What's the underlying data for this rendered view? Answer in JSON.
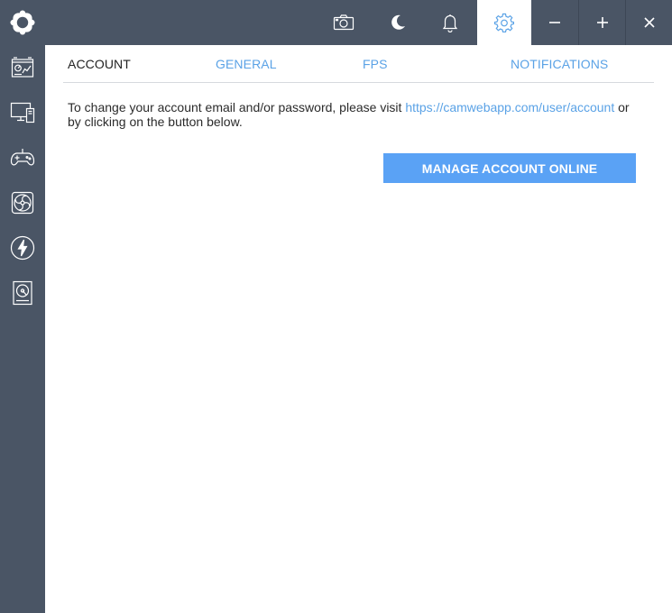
{
  "titlebar": {
    "buttons": [
      {
        "name": "screenshot",
        "icon": "camera-icon"
      },
      {
        "name": "dark-mode",
        "icon": "moon-icon"
      },
      {
        "name": "notifications",
        "icon": "bell-icon"
      },
      {
        "name": "settings",
        "icon": "gear-icon",
        "active": true
      },
      {
        "name": "minimize",
        "icon": "minus-icon"
      },
      {
        "name": "maximize",
        "icon": "plus-icon"
      },
      {
        "name": "close",
        "icon": "close-icon"
      }
    ]
  },
  "sidebar": {
    "items": [
      {
        "icon": "dashboard-icon"
      },
      {
        "icon": "monitor-icon"
      },
      {
        "icon": "gamepad-icon"
      },
      {
        "icon": "fan-icon"
      },
      {
        "icon": "lightning-icon"
      },
      {
        "icon": "storage-drive-icon"
      }
    ]
  },
  "tabs": [
    {
      "label": "ACCOUNT",
      "active": true
    },
    {
      "label": "GENERAL",
      "active": false
    },
    {
      "label": "FPS",
      "active": false
    },
    {
      "label": "NOTIFICATIONS",
      "active": false
    }
  ],
  "account": {
    "info_text": "To change your account email and/or password, please visit ",
    "link_text": "https://camwebapp.com/user/account",
    "info_text_2": " or by clicking on the button below.",
    "button_label": "MANAGE ACCOUNT ONLINE"
  },
  "colors": {
    "chrome": "#4a5565",
    "accent": "#5aa2f5",
    "link": "#5aa2e6",
    "content_bg": "#ffffff"
  }
}
